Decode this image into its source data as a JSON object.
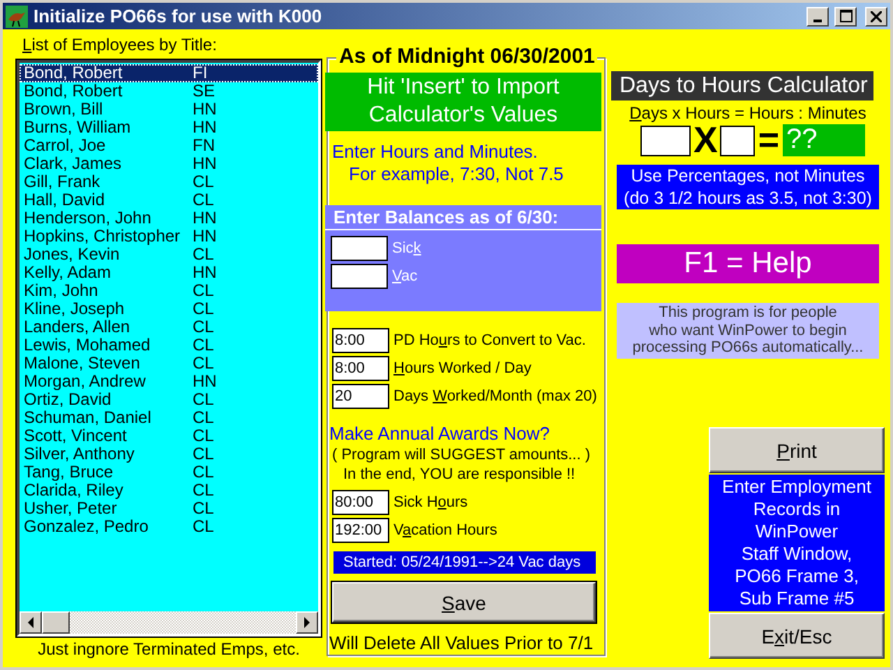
{
  "window": {
    "title": "Initialize PO66s for use with K000"
  },
  "employees": {
    "label": {
      "key": "L",
      "after": "ist of Employees by Title:"
    },
    "rows": [
      {
        "name": "Bond, Robert",
        "title": "FI",
        "selected": true
      },
      {
        "name": "Bond, Robert",
        "title": "SE",
        "selected": false
      },
      {
        "name": "Brown, Bill",
        "title": "HN",
        "selected": false
      },
      {
        "name": "Burns, William",
        "title": "HN",
        "selected": false
      },
      {
        "name": "Carrol, Joe",
        "title": "FN",
        "selected": false
      },
      {
        "name": "Clark, James",
        "title": "HN",
        "selected": false
      },
      {
        "name": "Gill, Frank",
        "title": "CL",
        "selected": false
      },
      {
        "name": "Hall, David",
        "title": "CL",
        "selected": false
      },
      {
        "name": "Henderson, John",
        "title": "HN",
        "selected": false
      },
      {
        "name": "Hopkins, Christopher",
        "title": "HN",
        "selected": false
      },
      {
        "name": "Jones, Kevin",
        "title": "CL",
        "selected": false
      },
      {
        "name": "Kelly, Adam",
        "title": "HN",
        "selected": false
      },
      {
        "name": "Kim, John",
        "title": "CL",
        "selected": false
      },
      {
        "name": "Kline, Joseph",
        "title": "CL",
        "selected": false
      },
      {
        "name": "Landers, Allen",
        "title": "CL",
        "selected": false
      },
      {
        "name": "Lewis, Mohamed",
        "title": "CL",
        "selected": false
      },
      {
        "name": "Malone, Steven",
        "title": "CL",
        "selected": false
      },
      {
        "name": "Morgan, Andrew",
        "title": "HN",
        "selected": false
      },
      {
        "name": "Ortiz, David",
        "title": "CL",
        "selected": false
      },
      {
        "name": "Schuman, Daniel",
        "title": "CL",
        "selected": false
      },
      {
        "name": "Scott, Vincent",
        "title": "CL",
        "selected": false
      },
      {
        "name": "Silver, Anthony",
        "title": "CL",
        "selected": false
      },
      {
        "name": "Tang, Bruce",
        "title": "CL",
        "selected": false
      },
      {
        "name": "Clarida, Riley",
        "title": "CL",
        "selected": false
      },
      {
        "name": "Usher, Peter",
        "title": "CL",
        "selected": false
      },
      {
        "name": "Gonzalez, Pedro",
        "title": "CL",
        "selected": false
      }
    ],
    "footer": "Just ingnore Terminated Emps, etc."
  },
  "balances_group": {
    "legend": "As of Midnight 06/30/2001",
    "import_banner": [
      "Hit 'Insert' to Import",
      "Calculator's Values"
    ],
    "instructions": [
      "Enter Hours and Minutes.",
      "For example, 7:30, Not 7.5"
    ],
    "balances": {
      "heading": "Enter Balances as of 6/30:",
      "fields": [
        {
          "label": {
            "before": "Sic",
            "key": "k"
          }
        },
        {
          "label": {
            "key": "V",
            "after": "ac"
          }
        }
      ]
    },
    "settings": [
      {
        "value": "8:00",
        "label": {
          "before": "PD Ho",
          "key": "u",
          "after": "rs to Convert to Vac."
        }
      },
      {
        "value": "8:00",
        "label": {
          "key": "H",
          "after": "ours Worked / Day"
        }
      },
      {
        "value": "20",
        "label": {
          "before": "Days ",
          "key": "W",
          "after": "orked/Month (max 20)"
        }
      }
    ],
    "awards_heading": "Make Annual Awards Now?",
    "awards_note": [
      "(  Program will SUGGEST amounts... )",
      "In the end, YOU are responsible !!"
    ],
    "awards": [
      {
        "value": "80:00",
        "label": {
          "before": "Sick H",
          "key": "o",
          "after": "urs"
        }
      },
      {
        "value": "192:00",
        "label": {
          "before": "V",
          "key": "a",
          "after": "cation Hours"
        }
      }
    ],
    "started": "Started: 05/24/1991-->24 Vac days",
    "save_button": {
      "key": "S",
      "after": "ave"
    },
    "warning": "Will Delete All Values Prior to 7/1"
  },
  "calculator": {
    "title": "Days to Hours Calculator",
    "formula": {
      "key": "D",
      "after": "ays x Hours = Hours : Minutes"
    },
    "times": "X",
    "equals": "=",
    "result": "??",
    "note": [
      "Use Percentages, not Minutes",
      "(do 3 1/2 hours as 3.5, not 3:30)"
    ]
  },
  "help": "F1 = Help",
  "about": [
    "This program is for people",
    "who want WinPower to begin",
    "processing PO66s automatically..."
  ],
  "print_button": {
    "key": "P",
    "after": "rint"
  },
  "employment_note": [
    "Enter Employment",
    "Records in",
    "WinPower",
    "Staff Window,",
    "PO66 Frame 3,",
    "Sub Frame #5"
  ],
  "exit_button": {
    "before": "E",
    "key": "x",
    "after": "it/Esc"
  }
}
